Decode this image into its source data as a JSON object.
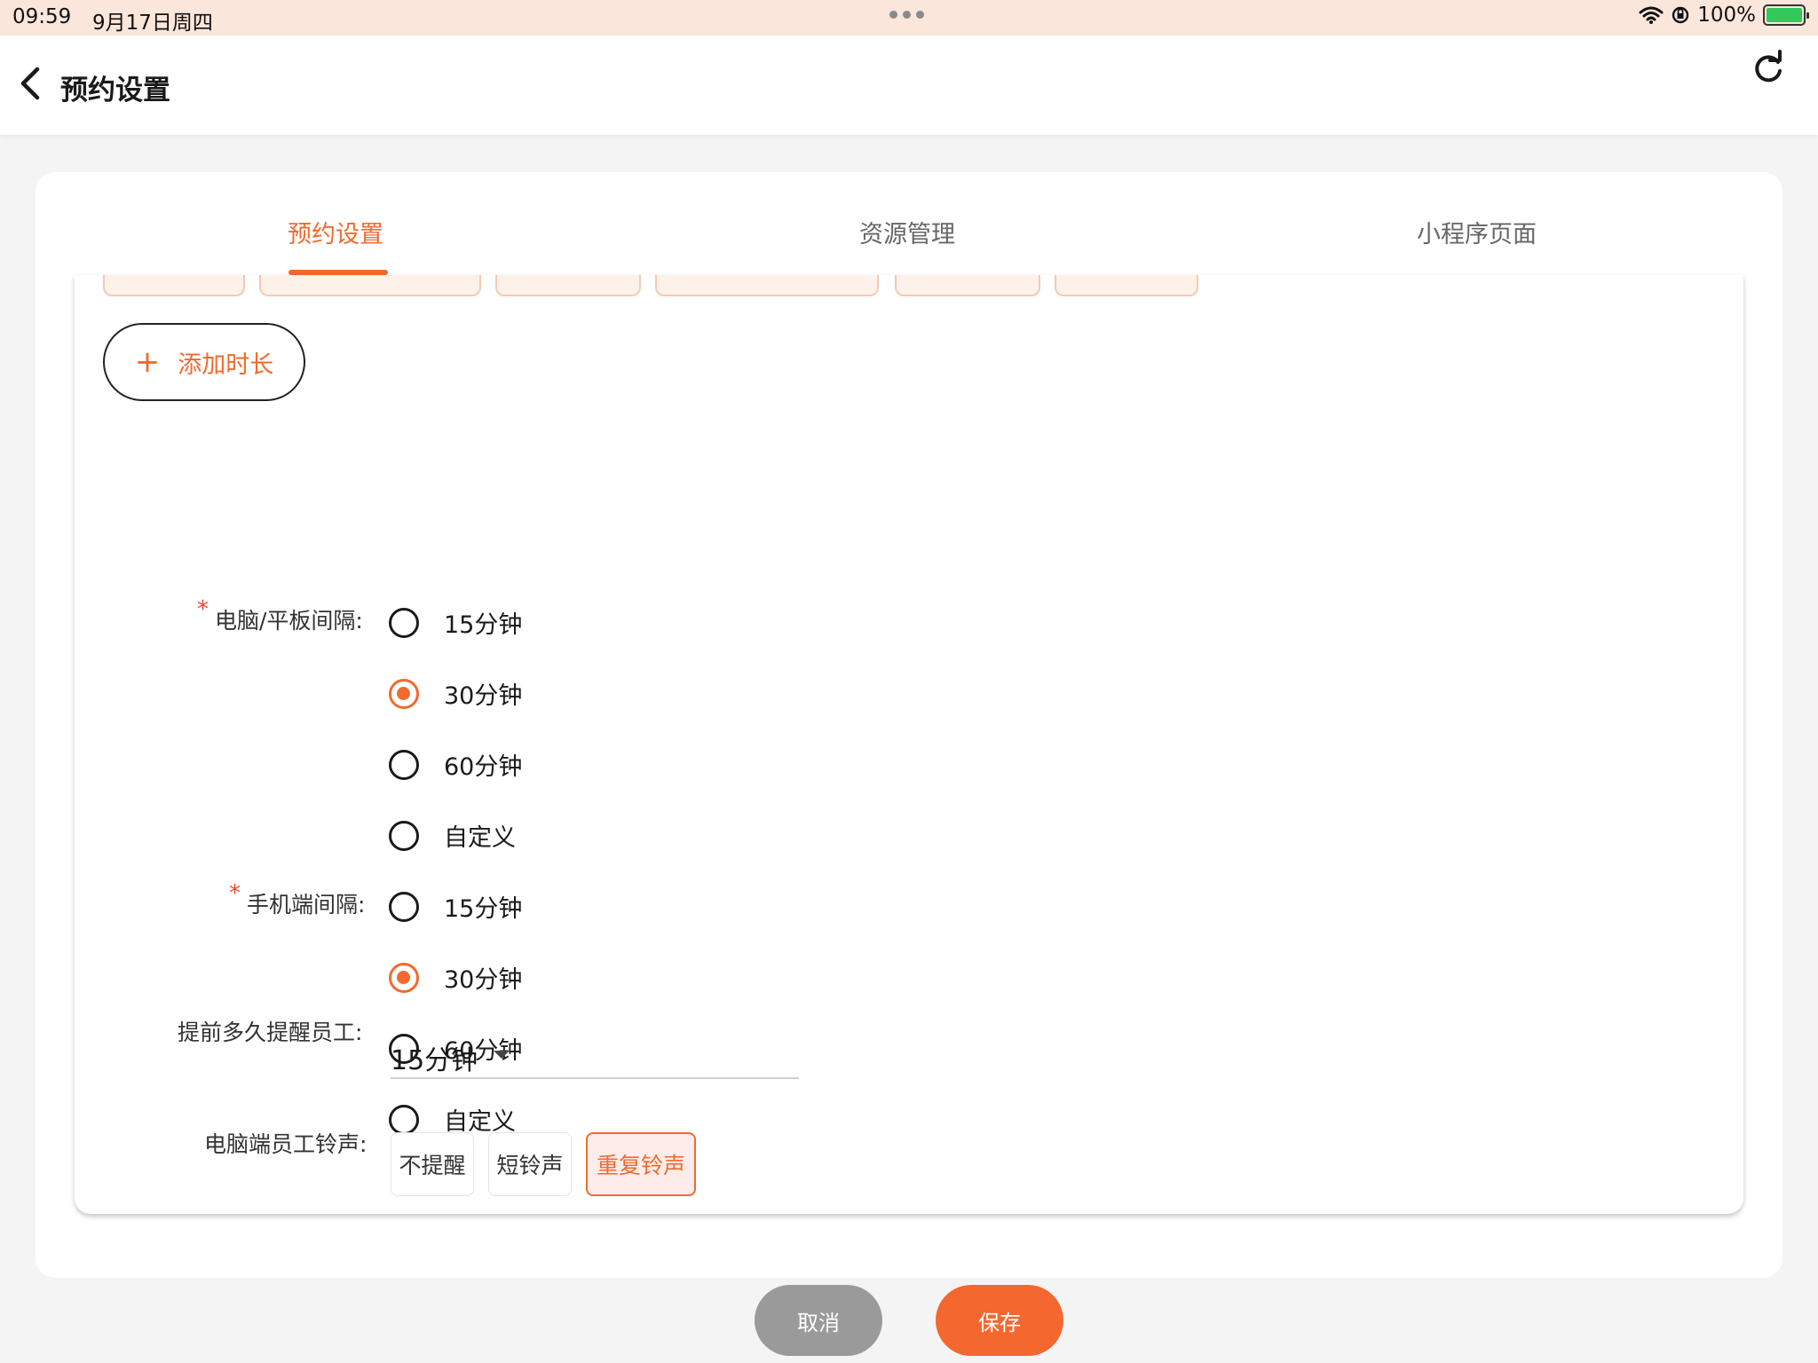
{
  "status_bar": {
    "time": "09:59",
    "date": "9月17日周四",
    "battery": "100%"
  },
  "nav": {
    "title": "预约设置",
    "back_icon": "chevron-left-icon",
    "refresh_icon": "refresh-icon"
  },
  "tabs": [
    {
      "label": "预约设置",
      "active": true
    },
    {
      "label": "资源管理",
      "active": false
    },
    {
      "label": "小程序页面",
      "active": false
    }
  ],
  "add_duration": {
    "icon": "+",
    "label": "添加时长"
  },
  "required_mark": "*",
  "pc_interval": {
    "label": "电脑/平板间隔:",
    "options": [
      "15分钟",
      "30分钟",
      "60分钟",
      "自定义"
    ],
    "selected": "30分钟"
  },
  "mobile_interval": {
    "label": "手机端间隔:",
    "options": [
      "15分钟",
      "30分钟",
      "60分钟",
      "自定义"
    ],
    "selected": "30分钟"
  },
  "reminder": {
    "label": "提前多久提醒员工:",
    "value": "15分钟"
  },
  "ringtone": {
    "label": "电脑端员工铃声:",
    "options": [
      "不提醒",
      "短铃声",
      "重复铃声"
    ],
    "selected": "重复铃声"
  },
  "footer": {
    "cancel": "取消",
    "save": "保存"
  },
  "colors": {
    "accent": "#f26a2e",
    "required": "#f0452e",
    "cancel": "#9a9a9a"
  }
}
